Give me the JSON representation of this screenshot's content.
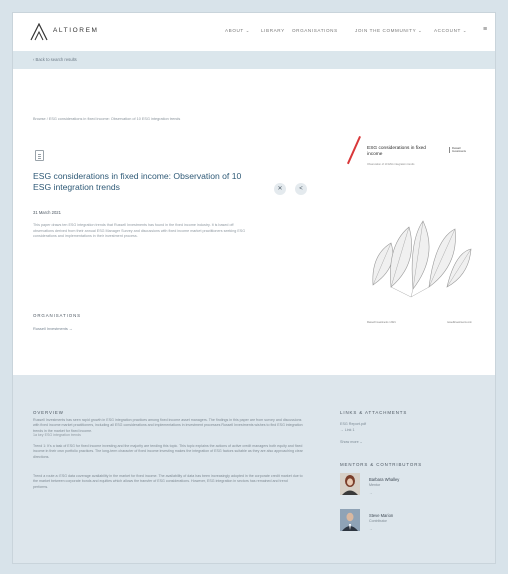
{
  "brand": {
    "name": "ALTIOREM"
  },
  "nav": {
    "items": [
      {
        "label": "ABOUT ⌄"
      },
      {
        "label": "LIBRARY"
      },
      {
        "label": "ORGANISATIONS"
      },
      {
        "label": "JOIN THE COMMUNITY ⌄"
      },
      {
        "label": "ACCOUNT ⌄"
      }
    ],
    "icon": "menu-icon"
  },
  "breadcrumb": {
    "back_label": "‹ Back to search results"
  },
  "document": {
    "path": "Browse / ESG considerations in fixed income: Observation of 10 ESG integration trends",
    "title": "ESG considerations in fixed income: Observation of 10 ESG integration trends",
    "date": "31 March 2021",
    "description": "This paper draws ten ESG integration trends that Russell Investments has found in the fixed income industry. It is based off observations derived from their annual ESG Manager Survey and discussions with fixed income market practitioners seeking ESG considerations and implementations in their investment process.",
    "share_icons": [
      "share-x-icon",
      "share-link-icon"
    ]
  },
  "cover": {
    "title": "ESG considerations in fixed income",
    "subtitle": "Observation of 10 ESG integration trends",
    "brand": "Russell Investments",
    "footer_left": "Russell Investments / 2021",
    "footer_right": "russellinvestments.com",
    "accent": "#d9383a"
  },
  "organisations": {
    "heading": "ORGANISATIONS",
    "link": "Russell Investments →"
  },
  "overview": {
    "heading": "OVERVIEW",
    "paragraph1": "Russell Investments has seen rapid growth in ESG integration practices among fixed income asset managers. The findings in this paper are from survey and discussions with fixed income market practitioners, including all ESG considerations and implementations in investment processes Russell Investments wishes to find ESG integration trends in the market for fixed income.",
    "note": "1a key ESG integration trends",
    "paragraph2": "Trend 1: It's a task of ESG for fixed income investing and the majority are tending this topic. This topic explains the actions of active credit managers both equity and fixed income in their own portfolio practices. The long-term character of fixed income investing makes the integration of ESG factors suitable as they are also approaching clear directions.",
    "paragraph3": "Trend a route a: ESG data coverage availability in the market for fixed income. The availability of data has been increasingly adopted in the corporate credit market due to the market between corporate bonds and equities which allows the transfer of ESG considerations. However, ESG integration in sectors has remained and trend performs."
  },
  "links": {
    "heading": "LINKS & ATTACHMENTS",
    "items": [
      "ESG Report.pdf",
      "→ Link 1"
    ],
    "more": "Show more ⌄"
  },
  "contributors": {
    "heading": "MENTORS & CONTRIBUTORS",
    "people": [
      {
        "name": "Barbara Whalley",
        "role": "Mentor",
        "arrow": "→"
      },
      {
        "name": "Steve Marion",
        "role": "Contributor",
        "arrow": "→"
      }
    ]
  }
}
